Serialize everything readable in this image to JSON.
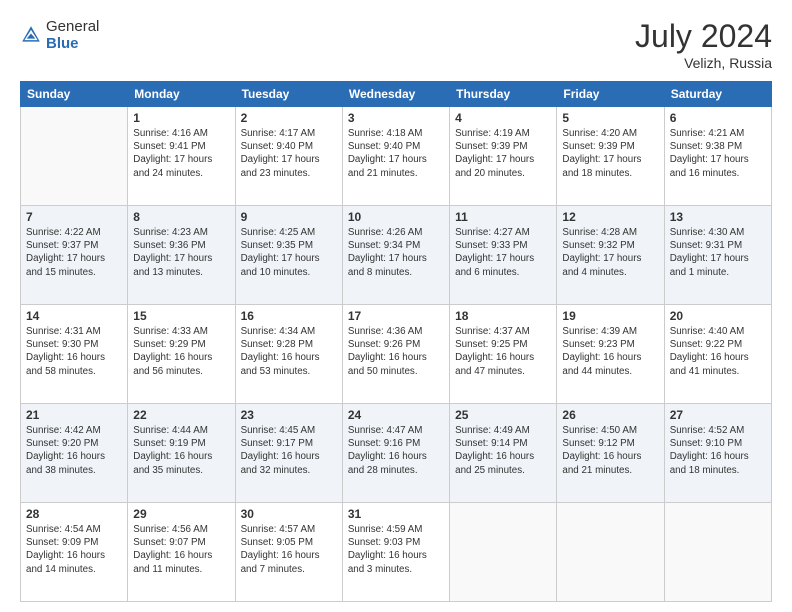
{
  "header": {
    "logo_general": "General",
    "logo_blue": "Blue",
    "month_year": "July 2024",
    "location": "Velizh, Russia"
  },
  "days_of_week": [
    "Sunday",
    "Monday",
    "Tuesday",
    "Wednesday",
    "Thursday",
    "Friday",
    "Saturday"
  ],
  "weeks": [
    [
      {
        "day": "",
        "sunrise": "",
        "sunset": "",
        "daylight": ""
      },
      {
        "day": "1",
        "sunrise": "Sunrise: 4:16 AM",
        "sunset": "Sunset: 9:41 PM",
        "daylight": "Daylight: 17 hours and 24 minutes."
      },
      {
        "day": "2",
        "sunrise": "Sunrise: 4:17 AM",
        "sunset": "Sunset: 9:40 PM",
        "daylight": "Daylight: 17 hours and 23 minutes."
      },
      {
        "day": "3",
        "sunrise": "Sunrise: 4:18 AM",
        "sunset": "Sunset: 9:40 PM",
        "daylight": "Daylight: 17 hours and 21 minutes."
      },
      {
        "day": "4",
        "sunrise": "Sunrise: 4:19 AM",
        "sunset": "Sunset: 9:39 PM",
        "daylight": "Daylight: 17 hours and 20 minutes."
      },
      {
        "day": "5",
        "sunrise": "Sunrise: 4:20 AM",
        "sunset": "Sunset: 9:39 PM",
        "daylight": "Daylight: 17 hours and 18 minutes."
      },
      {
        "day": "6",
        "sunrise": "Sunrise: 4:21 AM",
        "sunset": "Sunset: 9:38 PM",
        "daylight": "Daylight: 17 hours and 16 minutes."
      }
    ],
    [
      {
        "day": "7",
        "sunrise": "Sunrise: 4:22 AM",
        "sunset": "Sunset: 9:37 PM",
        "daylight": "Daylight: 17 hours and 15 minutes."
      },
      {
        "day": "8",
        "sunrise": "Sunrise: 4:23 AM",
        "sunset": "Sunset: 9:36 PM",
        "daylight": "Daylight: 17 hours and 13 minutes."
      },
      {
        "day": "9",
        "sunrise": "Sunrise: 4:25 AM",
        "sunset": "Sunset: 9:35 PM",
        "daylight": "Daylight: 17 hours and 10 minutes."
      },
      {
        "day": "10",
        "sunrise": "Sunrise: 4:26 AM",
        "sunset": "Sunset: 9:34 PM",
        "daylight": "Daylight: 17 hours and 8 minutes."
      },
      {
        "day": "11",
        "sunrise": "Sunrise: 4:27 AM",
        "sunset": "Sunset: 9:33 PM",
        "daylight": "Daylight: 17 hours and 6 minutes."
      },
      {
        "day": "12",
        "sunrise": "Sunrise: 4:28 AM",
        "sunset": "Sunset: 9:32 PM",
        "daylight": "Daylight: 17 hours and 4 minutes."
      },
      {
        "day": "13",
        "sunrise": "Sunrise: 4:30 AM",
        "sunset": "Sunset: 9:31 PM",
        "daylight": "Daylight: 17 hours and 1 minute."
      }
    ],
    [
      {
        "day": "14",
        "sunrise": "Sunrise: 4:31 AM",
        "sunset": "Sunset: 9:30 PM",
        "daylight": "Daylight: 16 hours and 58 minutes."
      },
      {
        "day": "15",
        "sunrise": "Sunrise: 4:33 AM",
        "sunset": "Sunset: 9:29 PM",
        "daylight": "Daylight: 16 hours and 56 minutes."
      },
      {
        "day": "16",
        "sunrise": "Sunrise: 4:34 AM",
        "sunset": "Sunset: 9:28 PM",
        "daylight": "Daylight: 16 hours and 53 minutes."
      },
      {
        "day": "17",
        "sunrise": "Sunrise: 4:36 AM",
        "sunset": "Sunset: 9:26 PM",
        "daylight": "Daylight: 16 hours and 50 minutes."
      },
      {
        "day": "18",
        "sunrise": "Sunrise: 4:37 AM",
        "sunset": "Sunset: 9:25 PM",
        "daylight": "Daylight: 16 hours and 47 minutes."
      },
      {
        "day": "19",
        "sunrise": "Sunrise: 4:39 AM",
        "sunset": "Sunset: 9:23 PM",
        "daylight": "Daylight: 16 hours and 44 minutes."
      },
      {
        "day": "20",
        "sunrise": "Sunrise: 4:40 AM",
        "sunset": "Sunset: 9:22 PM",
        "daylight": "Daylight: 16 hours and 41 minutes."
      }
    ],
    [
      {
        "day": "21",
        "sunrise": "Sunrise: 4:42 AM",
        "sunset": "Sunset: 9:20 PM",
        "daylight": "Daylight: 16 hours and 38 minutes."
      },
      {
        "day": "22",
        "sunrise": "Sunrise: 4:44 AM",
        "sunset": "Sunset: 9:19 PM",
        "daylight": "Daylight: 16 hours and 35 minutes."
      },
      {
        "day": "23",
        "sunrise": "Sunrise: 4:45 AM",
        "sunset": "Sunset: 9:17 PM",
        "daylight": "Daylight: 16 hours and 32 minutes."
      },
      {
        "day": "24",
        "sunrise": "Sunrise: 4:47 AM",
        "sunset": "Sunset: 9:16 PM",
        "daylight": "Daylight: 16 hours and 28 minutes."
      },
      {
        "day": "25",
        "sunrise": "Sunrise: 4:49 AM",
        "sunset": "Sunset: 9:14 PM",
        "daylight": "Daylight: 16 hours and 25 minutes."
      },
      {
        "day": "26",
        "sunrise": "Sunrise: 4:50 AM",
        "sunset": "Sunset: 9:12 PM",
        "daylight": "Daylight: 16 hours and 21 minutes."
      },
      {
        "day": "27",
        "sunrise": "Sunrise: 4:52 AM",
        "sunset": "Sunset: 9:10 PM",
        "daylight": "Daylight: 16 hours and 18 minutes."
      }
    ],
    [
      {
        "day": "28",
        "sunrise": "Sunrise: 4:54 AM",
        "sunset": "Sunset: 9:09 PM",
        "daylight": "Daylight: 16 hours and 14 minutes."
      },
      {
        "day": "29",
        "sunrise": "Sunrise: 4:56 AM",
        "sunset": "Sunset: 9:07 PM",
        "daylight": "Daylight: 16 hours and 11 minutes."
      },
      {
        "day": "30",
        "sunrise": "Sunrise: 4:57 AM",
        "sunset": "Sunset: 9:05 PM",
        "daylight": "Daylight: 16 hours and 7 minutes."
      },
      {
        "day": "31",
        "sunrise": "Sunrise: 4:59 AM",
        "sunset": "Sunset: 9:03 PM",
        "daylight": "Daylight: 16 hours and 3 minutes."
      },
      {
        "day": "",
        "sunrise": "",
        "sunset": "",
        "daylight": ""
      },
      {
        "day": "",
        "sunrise": "",
        "sunset": "",
        "daylight": ""
      },
      {
        "day": "",
        "sunrise": "",
        "sunset": "",
        "daylight": ""
      }
    ]
  ]
}
